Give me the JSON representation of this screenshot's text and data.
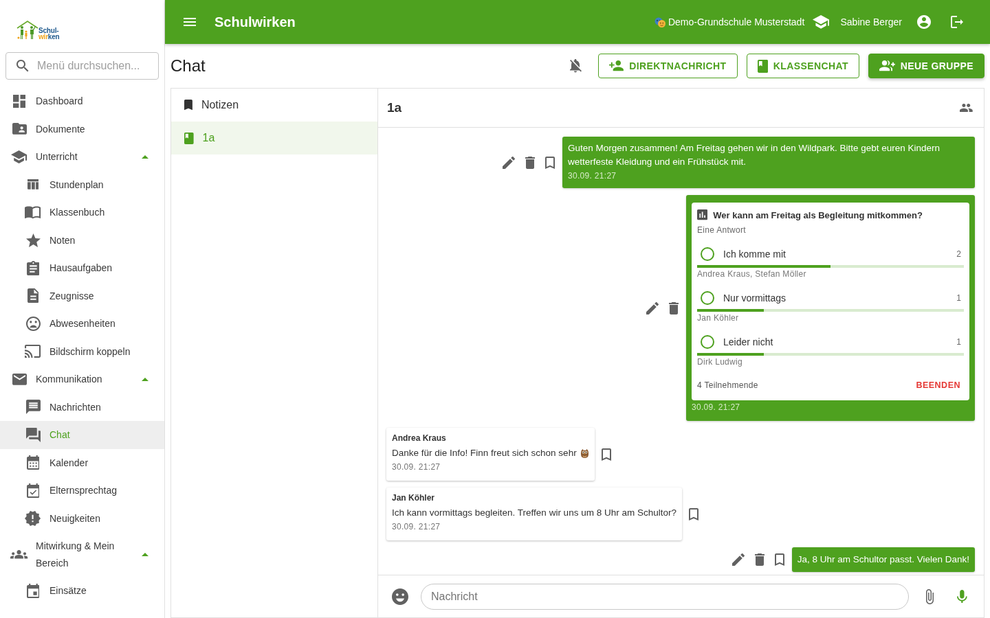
{
  "topbar": {
    "title": "Schulwirken",
    "school": "Demo-Grundschule Musterstadt",
    "user": "Sabine Berger"
  },
  "sidebar": {
    "logo": {
      "lines": [
        [
          {
            "text": "Schul-",
            "color": "#1f5a8e"
          }
        ],
        [
          {
            "text": "wir",
            "color": "#f0a51e"
          },
          {
            "text": "ken",
            "color": "#1f5a8e"
          }
        ]
      ]
    },
    "search": {
      "placeholder": "Menü durchsuchen..."
    },
    "items": [
      {
        "label": "Dashboard",
        "selected": false
      },
      {
        "label": "Dokumente",
        "selected": false
      },
      {
        "label": "Unterricht",
        "selected": false,
        "expanded": true,
        "children": [
          {
            "label": "Stundenplan",
            "selected": false
          },
          {
            "label": "Klassenbuch",
            "selected": false
          },
          {
            "label": "Noten",
            "selected": false
          },
          {
            "label": "Hausaufgaben",
            "selected": false
          },
          {
            "label": "Zeugnisse",
            "selected": false
          },
          {
            "label": "Abwesenheiten",
            "selected": false
          },
          {
            "label": "Bildschirm koppeln",
            "selected": false
          }
        ]
      },
      {
        "label": "Kommunikation",
        "selected": false,
        "expanded": true,
        "children": [
          {
            "label": "Nachrichten",
            "selected": false
          },
          {
            "label": "Chat",
            "selected": true
          },
          {
            "label": "Kalender",
            "selected": false
          },
          {
            "label": "Elternsprechtag",
            "selected": false
          },
          {
            "label": "Neuigkeiten",
            "selected": false
          }
        ]
      },
      {
        "label": "Mitwirkung & Mein Bereich",
        "selected": false,
        "expanded": true,
        "children": [
          {
            "label": "Einsätze",
            "selected": false
          }
        ]
      }
    ]
  },
  "page": {
    "title": "Chat",
    "actions": [
      {
        "label": "DIREKTNACHRICHT",
        "kind": "outlined"
      },
      {
        "label": "KLASSENCHAT",
        "kind": "outlined"
      },
      {
        "label": "NEUE GRUPPE",
        "kind": "filled"
      }
    ]
  },
  "conversations": [
    {
      "label": "Notizen",
      "selected": false
    },
    {
      "label": "1a",
      "selected": true
    }
  ],
  "chat": {
    "title": "1a",
    "messages": [
      {
        "kind": "sent",
        "text": "Guten Morgen zusammen! Am Freitag gehen wir in den Wildpark. Bitte gebt euren Kindern wetterfeste Kleidung und ein Frühstück mit.",
        "time": "30.09. 21:27"
      },
      {
        "kind": "poll",
        "poll": {
          "title": "Wer kann am Freitag als Begleitung mitkommen?",
          "mode": "Eine Antwort",
          "options": [
            {
              "label": "Ich komme mit",
              "count": "2",
              "level": 0.5,
              "voters": "Andrea Kraus, Stefan Möller",
              "selected": false
            },
            {
              "label": "Nur vormittags",
              "count": "1",
              "level": 0.25,
              "voters": "Jan Köhler",
              "selected": false
            },
            {
              "label": "Leider nicht",
              "count": "1",
              "level": 0.25,
              "voters": "Dirk Ludwig",
              "selected": false
            }
          ],
          "participants": "4 Teilnehmende",
          "end_label": "BEENDEN"
        },
        "time": "30.09. 21:27"
      },
      {
        "kind": "received",
        "author": "Andrea Kraus",
        "text": "Danke für die Info! Finn freut sich schon sehr",
        "emoji": true,
        "time": "30.09. 21:27"
      },
      {
        "kind": "received",
        "author": "Jan Köhler",
        "text": "Ich kann vormittags begleiten. Treffen wir uns um 8 Uhr am Schultor?",
        "emoji": false,
        "time": "30.09. 21:27"
      },
      {
        "kind": "sent",
        "text": "Ja, 8 Uhr am Schultor passt. Vielen Dank!"
      }
    ],
    "composer": {
      "placeholder": "Nachricht"
    }
  }
}
